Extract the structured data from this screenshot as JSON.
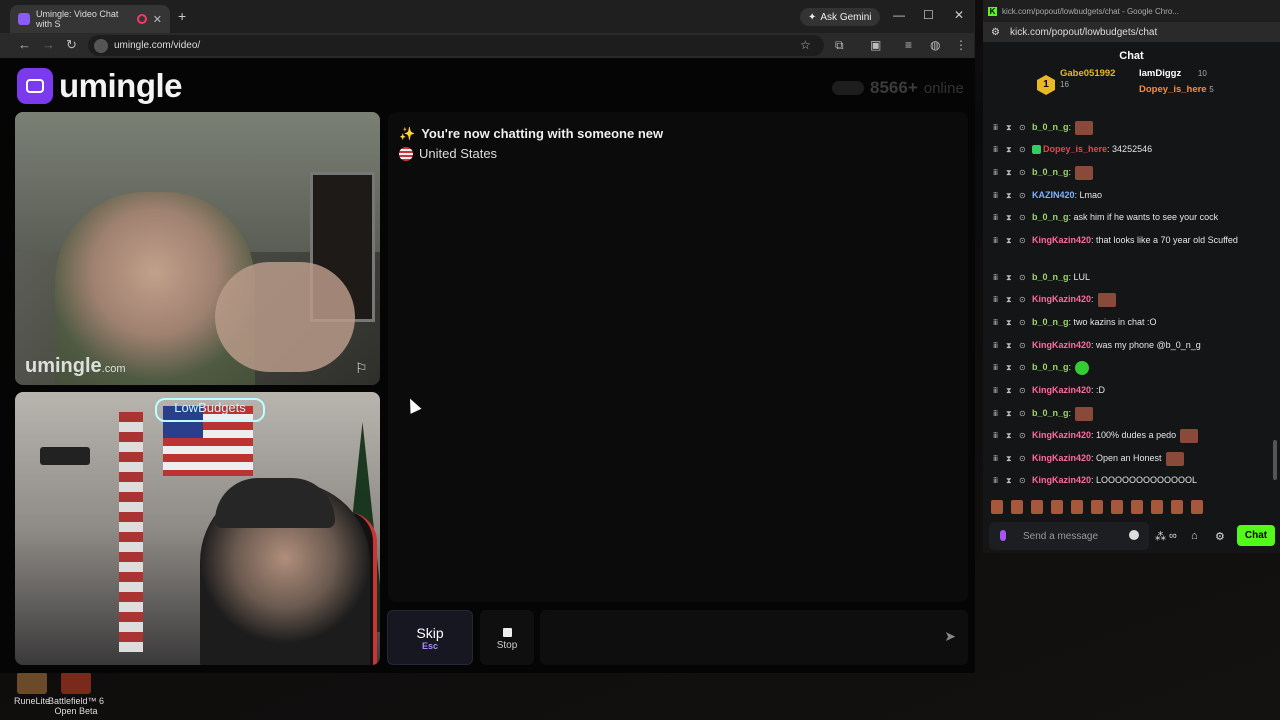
{
  "browser": {
    "tab_title": "Umingle: Video Chat with S",
    "new_tab": "+",
    "ask_gemini": "Ask Gemini",
    "url": "umingle.com/video/"
  },
  "page": {
    "logo_text": "umingle",
    "online_count": "8566+",
    "online_label": "online",
    "watermark_main": "umingle",
    "watermark_suffix": ".com",
    "neon_text": "LowBudgets",
    "system_message": "You're now chatting with someone new",
    "country": "United States",
    "skip_label": "Skip",
    "skip_key": "Esc",
    "stop_label": "Stop"
  },
  "desktop": {
    "icons": [
      {
        "label": "RuneLite"
      },
      {
        "label": "Battlefield™ 6 Open Beta"
      }
    ]
  },
  "kick": {
    "title_url": "kick.com/popout/lowbudgets/chat - Google Chro...",
    "url": "kick.com/popout/lowbudgets/chat",
    "header": "Chat",
    "leader1_name": "Gabe051992",
    "leader1_count": "16",
    "leader2_name": "IamDiggz",
    "leader2_count": "10",
    "leader3_name": "Dopey_is_here",
    "leader3_count": "5",
    "messages": [
      {
        "user": "b_0_n_g",
        "text": ":",
        "emote": true,
        "color": "#9bd86a"
      },
      {
        "user": "Dopey_is_here",
        "text": ": 34252546",
        "color": "#e8474a"
      },
      {
        "user": "b_0_n_g",
        "text": ":",
        "emote": true,
        "color": "#9bd86a"
      },
      {
        "user": "KAZIN420",
        "text": ": Lmao",
        "color": "#7fb2ff"
      },
      {
        "user": "b_0_n_g",
        "text": ": ask him if he wants to see your cock",
        "color": "#9bd86a"
      },
      {
        "user": "KingKazin420",
        "text": ": that looks like a 70 year old Scuffed",
        "color": "#ff6b9d"
      },
      {
        "user": "b_0_n_g",
        "text": ": LUL",
        "color": "#9bd86a"
      },
      {
        "user": "KingKazin420",
        "text": ":",
        "emote": true,
        "color": "#ff6b9d"
      },
      {
        "user": "b_0_n_g",
        "text": ": two kazins in chat :O",
        "color": "#9bd86a"
      },
      {
        "user": "KingKazin420",
        "text": ": was my phone @b_0_n_g",
        "color": "#ff6b9d"
      },
      {
        "user": "b_0_n_g",
        "text": ":",
        "emote": true,
        "color": "#9bd86a"
      },
      {
        "user": "KingKazin420",
        "text": ": :D",
        "color": "#ff6b9d"
      },
      {
        "user": "b_0_n_g",
        "text": ":",
        "emote": true,
        "color": "#9bd86a"
      },
      {
        "user": "KingKazin420",
        "text": ": 100% dudes a pedo",
        "emote": true,
        "color": "#ff6b9d"
      },
      {
        "user": "KingKazin420",
        "text": ": Open an Honest",
        "emote": true,
        "color": "#ff6b9d"
      },
      {
        "user": "KingKazin420",
        "text": ": LOOOOOOOOOOOOOL",
        "color": "#ff6b9d"
      }
    ],
    "input_placeholder": "Send a message",
    "chat_button": "Chat"
  }
}
